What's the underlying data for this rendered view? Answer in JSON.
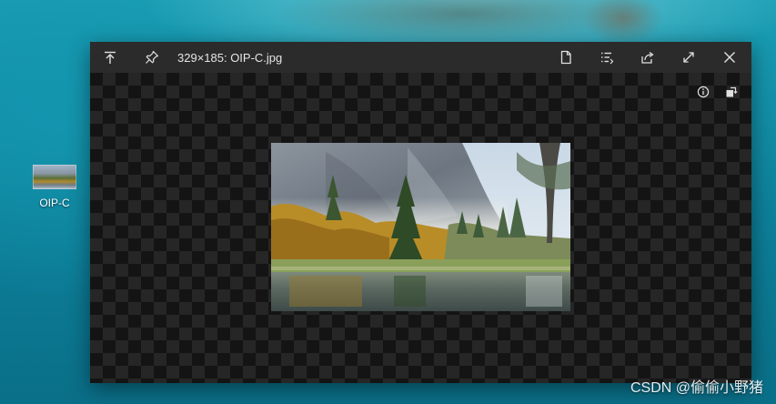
{
  "desktop": {
    "icon": {
      "label": "OIP-C"
    }
  },
  "viewer": {
    "title": "329×185: OIP-C.jpg",
    "toolbar": {
      "left": [
        "keep-on-top-icon",
        "pin-icon"
      ],
      "right": [
        "document-icon",
        "list-icon",
        "share-icon",
        "fullscreen-icon",
        "close-icon"
      ]
    },
    "canvas_tools": [
      "info-icon",
      "rotate-icon"
    ],
    "image": {
      "description_icon": "landscape-photo",
      "colors": {
        "sky": "#dfe9f1",
        "cliff": "#7f8791",
        "autumn": "#c99a2c",
        "pine": "#2f4a27",
        "grass": "#8aa05a",
        "water": "#5f6f6c"
      }
    }
  },
  "watermark": {
    "text": "CSDN @偷偷小野猪"
  }
}
